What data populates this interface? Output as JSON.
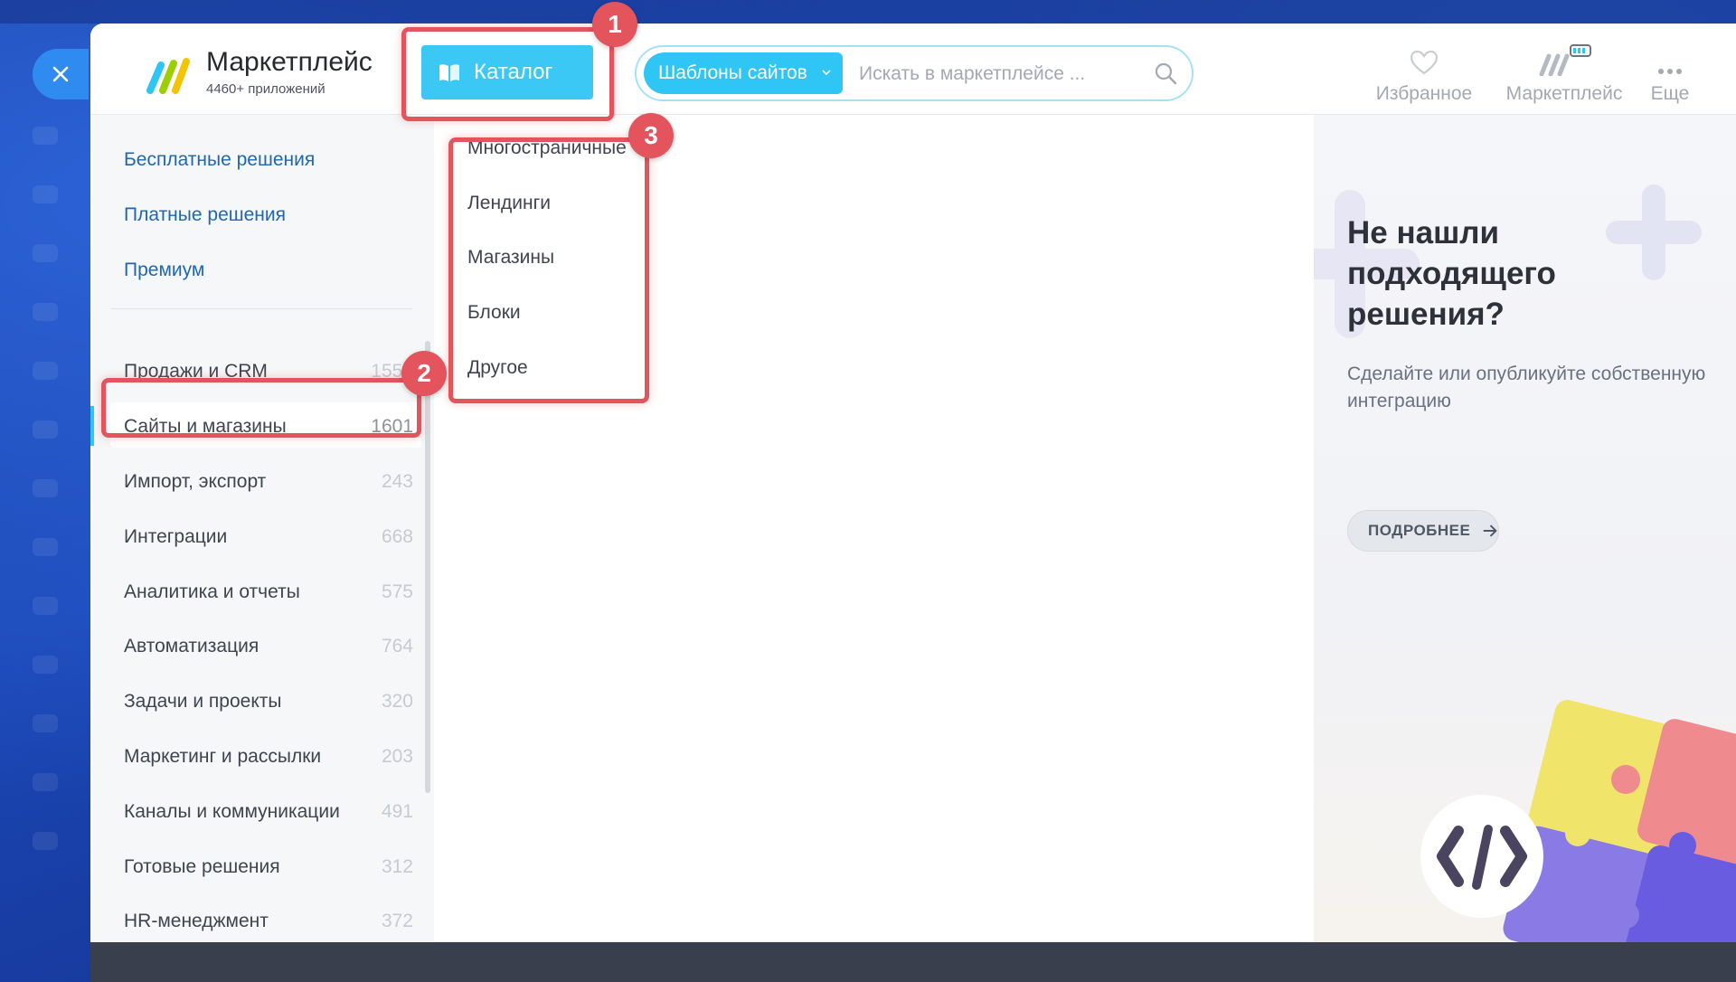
{
  "header": {
    "brand_name": "Маркетплейс",
    "brand_sub": "4460+ приложений",
    "catalog_label": "Каталог",
    "search_scope": "Шаблоны сайтов",
    "search_placeholder": "Искать в маркетплейсе ...",
    "actions": {
      "favorites": "Избранное",
      "marketplace": "Маркетплейс",
      "more": "Еще"
    }
  },
  "sidebar": {
    "links": [
      "Бесплатные решения",
      "Платные решения",
      "Премиум"
    ],
    "categories": [
      {
        "label": "Продажи и CRM",
        "count": "1550"
      },
      {
        "label": "Сайты и магазины",
        "count": "1601"
      },
      {
        "label": "Импорт, экспорт",
        "count": "243"
      },
      {
        "label": "Интеграции",
        "count": "668"
      },
      {
        "label": "Аналитика и отчеты",
        "count": "575"
      },
      {
        "label": "Автоматизация",
        "count": "764"
      },
      {
        "label": "Задачи и проекты",
        "count": "320"
      },
      {
        "label": "Маркетинг и рассылки",
        "count": "203"
      },
      {
        "label": "Каналы и коммуникации",
        "count": "491"
      },
      {
        "label": "Готовые решения",
        "count": "312"
      },
      {
        "label": "HR-менеджмент",
        "count": "372"
      }
    ],
    "active_category": "Сайты и магазины"
  },
  "submenu": {
    "items": [
      "Многостраничные",
      "Лендинги",
      "Магазины",
      "Блоки",
      "Другое"
    ]
  },
  "promo": {
    "title": "Не нашли подходящего решения?",
    "text": "Сделайте или опубликуйте собственную интеграцию",
    "button": "ПОДРОБНЕЕ"
  },
  "annotations": {
    "badge_1": "1",
    "badge_2": "2",
    "badge_3": "3",
    "color": "#e4545d"
  },
  "colors": {
    "accent": "#2fc6f6",
    "link": "#2067b0",
    "annotation": "#e4545d"
  }
}
